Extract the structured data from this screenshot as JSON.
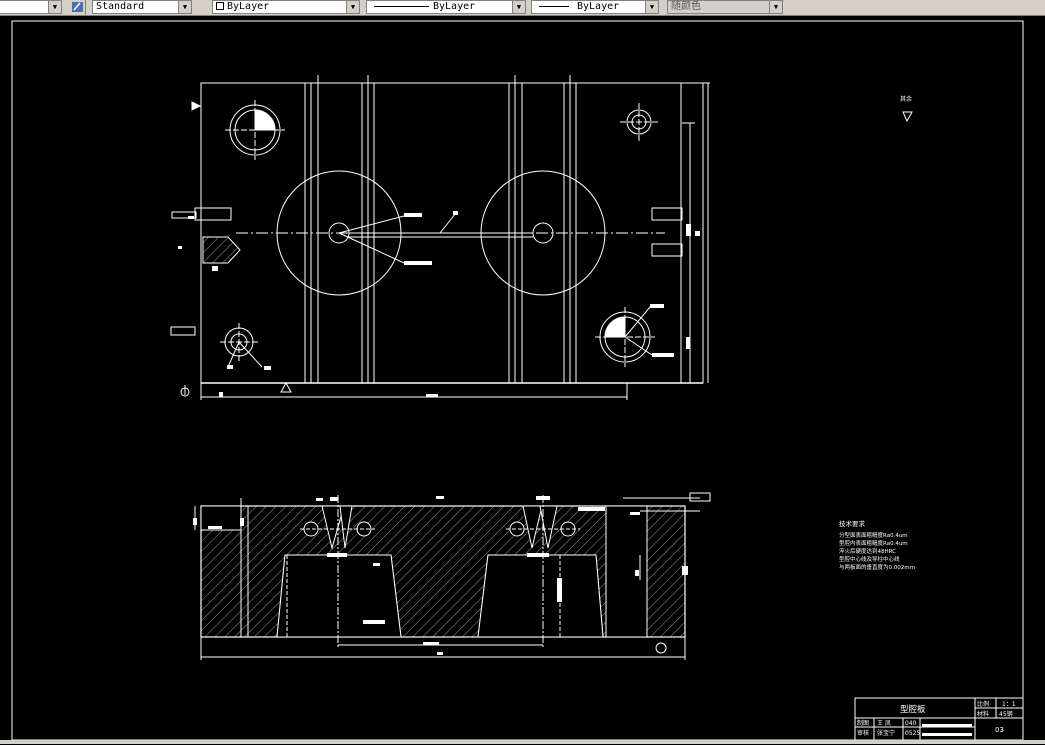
{
  "toolbar": {
    "text_style": "Standard",
    "layer": "ByLayer",
    "linetype": "ByLayer",
    "lineweight": "ByLayer",
    "color": "随颜色"
  },
  "notes": {
    "title": "技术要求",
    "lines": [
      "分型面表面粗糙度Ra0.4um",
      "型腔内表面粗糙度Ra0.4um",
      "淬火后硬度达到48HRC",
      "型腔中心线及导柱中心线",
      "与两板面的垂直度为0.002mm"
    ]
  },
  "roughness_label": "其余",
  "title_block": {
    "part_name": "型腔板",
    "scale_label": "比例",
    "scale_value": "1：1",
    "material_label": "材料",
    "material_value": "45钢",
    "drawn_label": "制图",
    "drawn_name": "王 凤",
    "drawn_code": "040",
    "checked_label": "审核",
    "checked_name": "张宝宁",
    "checked_code": "0525",
    "sheet": "03"
  }
}
